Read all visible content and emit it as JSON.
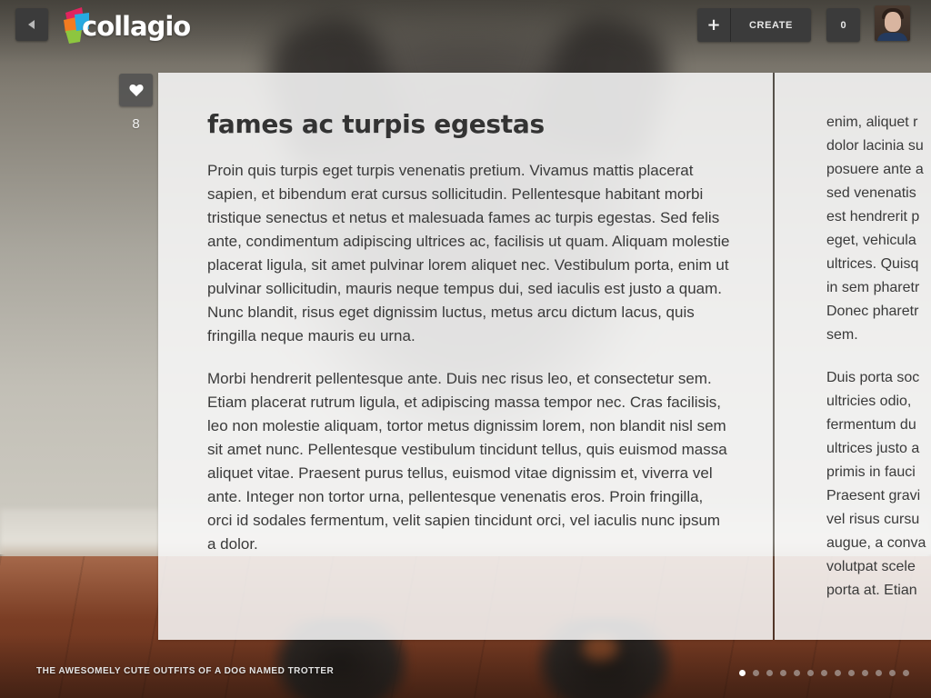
{
  "header": {
    "back_icon": "back-arrow-icon",
    "logo_text": "collagio",
    "create_icon": "plus-icon",
    "create_label": "CREATE",
    "count": "0",
    "avatar": "user-avatar"
  },
  "like": {
    "icon": "heart-icon",
    "count": "8"
  },
  "article": {
    "title": "fames ac turpis egestas",
    "paragraphs": [
      "Proin quis turpis eget turpis venenatis pretium. Vivamus mattis placerat sapien, et bibendum erat cursus sollicitudin. Pellentesque habitant morbi tristique senectus et netus et malesuada fames ac turpis egestas. Sed felis ante, condimentum adipiscing ultrices ac, facilisis ut quam. Aliquam molestie placerat ligula, sit amet pulvinar lorem aliquet nec. Vestibulum porta, enim ut pulvinar sollicitudin, mauris neque tempus dui, sed iaculis est justo a quam. Nunc blandit, risus eget dignissim luctus, metus arcu dictum lacus, quis fringilla neque mauris eu urna.",
      "Morbi hendrerit pellentesque ante. Duis nec risus leo, et consectetur sem. Etiam placerat rutrum ligula, et adipiscing massa tempor nec. Cras facilisis, leo non molestie aliquam, tortor metus dignissim lorem, non blandit nisl sem sit amet nunc. Pellentesque vestibulum tincidunt tellus, quis euismod massa aliquet vitae. Praesent purus tellus, euismod vitae dignissim et, viverra vel ante. Integer non tortor urna, pellentesque venenatis eros. Proin fringilla, orci id sodales fermentum, velit sapien tincidunt orci, vel iaculis nunc ipsum a dolor."
    ]
  },
  "next_page": {
    "paragraph_1_lines": [
      "enim, aliquet r",
      "dolor lacinia su",
      "posuere ante a",
      "sed venenatis",
      "est hendrerit p",
      "eget, vehicula",
      "ultrices. Quisq",
      "in sem pharetr",
      "Donec pharetr",
      "sem."
    ],
    "paragraph_2_lines": [
      "Duis porta soc",
      "ultricies odio,",
      "fermentum du",
      "ultrices justo a",
      "primis in fauci",
      "Praesent gravi",
      "vel risus cursu",
      "augue, a conva",
      "volutpat scele",
      "porta at. Etian"
    ]
  },
  "footer": {
    "caption": "THE AWESOMELY CUTE OUTFITS OF A DOG NAMED TROTTER",
    "pager_total": 13,
    "pager_active": 0
  },
  "colors": {
    "button_dark": "#3b3b3b",
    "panel_bg": "#f6f6f6",
    "text": "#3a3a3a",
    "logo_orange": "#f47b20",
    "logo_green": "#8dc63f",
    "logo_blue": "#27aae1",
    "logo_red": "#e0245e"
  }
}
